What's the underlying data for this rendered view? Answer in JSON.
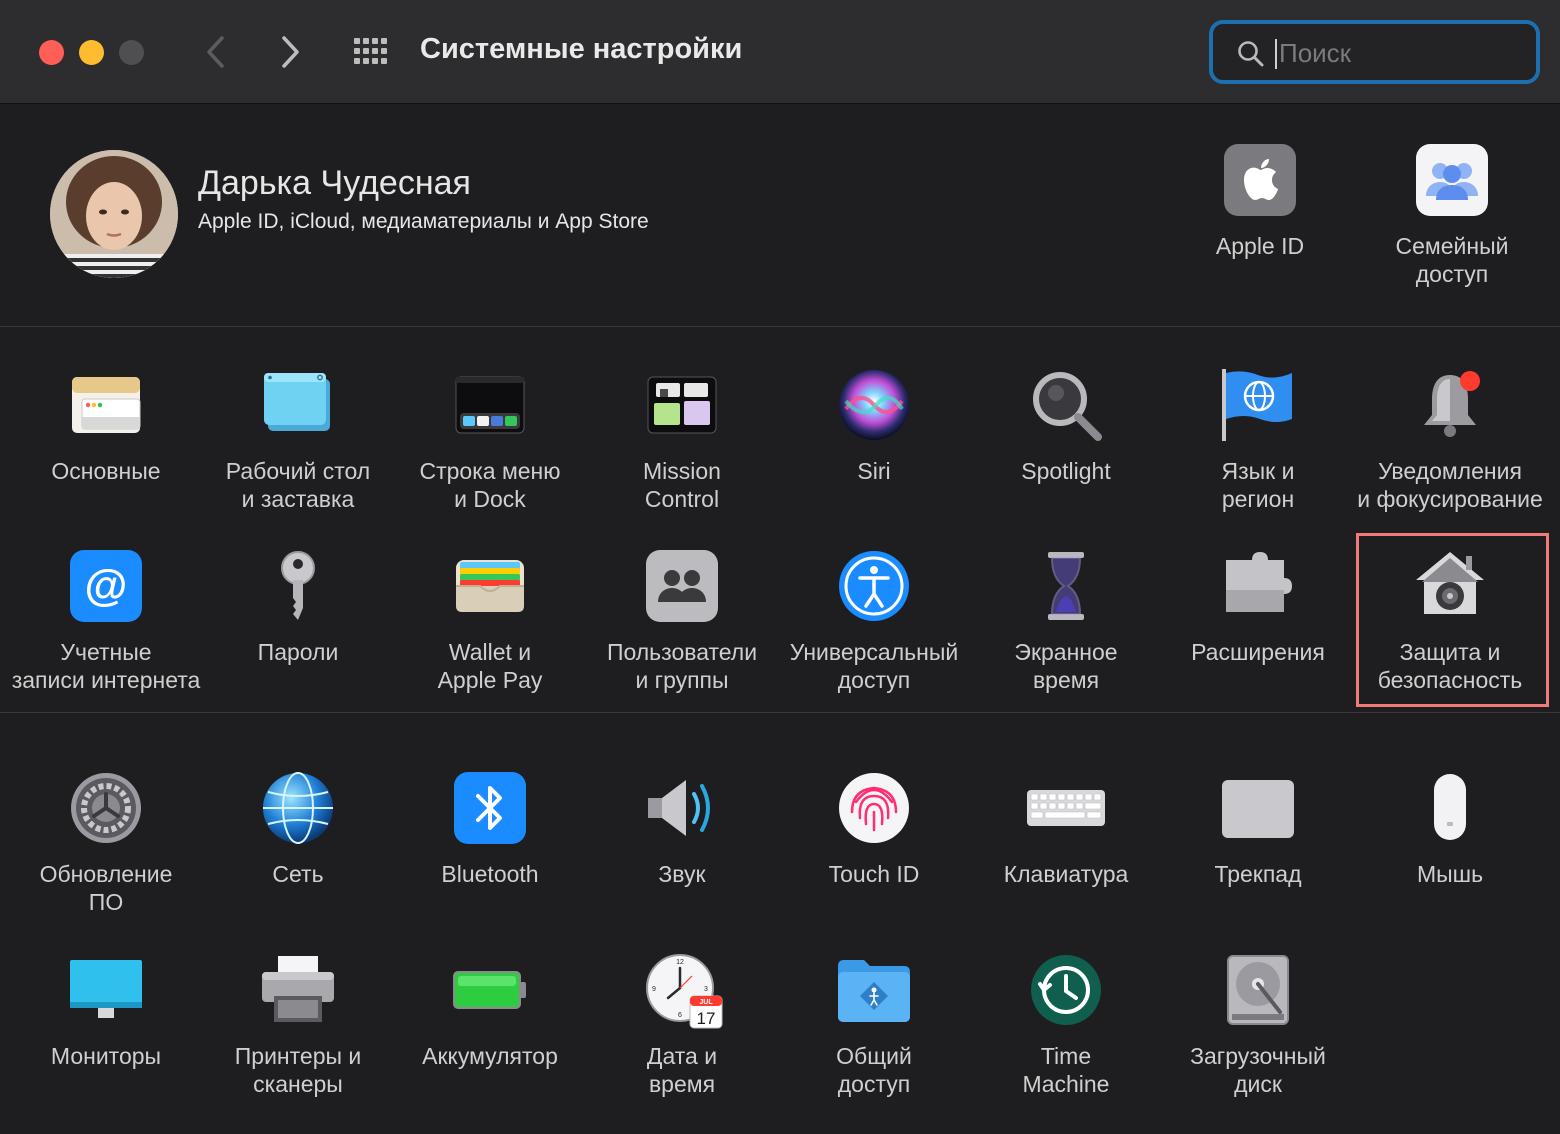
{
  "window": {
    "title": "Системные настройки"
  },
  "search": {
    "placeholder": "Поиск",
    "value": ""
  },
  "profile": {
    "name": "Дарька Чудесная",
    "subtitle": "Apple ID, iCloud, медиаматериалы и App Store"
  },
  "top_items": [
    {
      "label": "Apple ID",
      "icon": "apple-id-icon"
    },
    {
      "label": "Семейный\nдоступ",
      "icon": "family-sharing-icon"
    }
  ],
  "panes": [
    {
      "label": "Основные",
      "icon": "general-icon"
    },
    {
      "label": "Рабочий стол\nи заставка",
      "icon": "desktop-screensaver-icon"
    },
    {
      "label": "Строка меню\nи Dock",
      "icon": "menubar-dock-icon"
    },
    {
      "label": "Mission\nControl",
      "icon": "mission-control-icon"
    },
    {
      "label": "Siri",
      "icon": "siri-icon"
    },
    {
      "label": "Spotlight",
      "icon": "spotlight-icon"
    },
    {
      "label": "Язык и\nрегион",
      "icon": "language-region-icon"
    },
    {
      "label": "Уведомления\nи фокусирование",
      "icon": "notifications-bell-icon"
    },
    {
      "label": "Учетные\nзаписи интернета",
      "icon": "internet-accounts-icon"
    },
    {
      "label": "Пароли",
      "icon": "passwords-key-icon"
    },
    {
      "label": "Wallet и\nApple Pay",
      "icon": "wallet-icon"
    },
    {
      "label": "Пользователи\nи группы",
      "icon": "users-groups-icon"
    },
    {
      "label": "Универсальный\nдоступ",
      "icon": "accessibility-icon"
    },
    {
      "label": "Экранное\nвремя",
      "icon": "screen-time-hourglass-icon"
    },
    {
      "label": "Расширения",
      "icon": "extensions-puzzle-icon"
    },
    {
      "label": "Защита и\nбезопасность",
      "icon": "security-house-icon"
    },
    {
      "label": "Обновление\nПО",
      "icon": "software-update-gear-icon"
    },
    {
      "label": "Сеть",
      "icon": "network-globe-icon"
    },
    {
      "label": "Bluetooth",
      "icon": "bluetooth-icon"
    },
    {
      "label": "Звук",
      "icon": "sound-speaker-icon"
    },
    {
      "label": "Touch ID",
      "icon": "touch-id-fingerprint-icon"
    },
    {
      "label": "Клавиатура",
      "icon": "keyboard-icon"
    },
    {
      "label": "Трекпад",
      "icon": "trackpad-icon"
    },
    {
      "label": "Мышь",
      "icon": "mouse-icon"
    },
    {
      "label": "Мониторы",
      "icon": "displays-monitor-icon"
    },
    {
      "label": "Принтеры и\nсканеры",
      "icon": "printer-icon"
    },
    {
      "label": "Аккумулятор",
      "icon": "battery-icon"
    },
    {
      "label": "Дата и\nвремя",
      "icon": "date-time-clock-icon"
    },
    {
      "label": "Общий\nдоступ",
      "icon": "sharing-folder-icon"
    },
    {
      "label": "Time\nMachine",
      "icon": "time-machine-icon"
    },
    {
      "label": "Загрузочный\nдиск",
      "icon": "startup-disk-icon"
    }
  ],
  "calendar_badge": {
    "month": "JUL",
    "day": "17"
  },
  "colors": {
    "accent": "#1e6fb0",
    "highlight": "#f27a7a",
    "background": "#1e1e20"
  }
}
